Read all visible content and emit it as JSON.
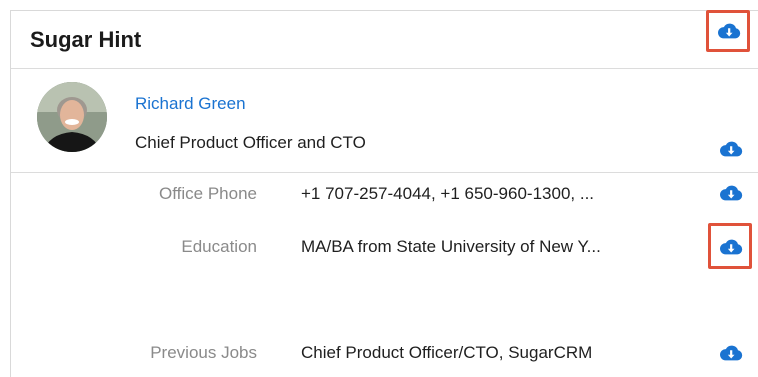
{
  "panel": {
    "title": "Sugar Hint"
  },
  "person": {
    "name": "Richard Green",
    "title": "Chief Product Officer and CTO"
  },
  "fields": [
    {
      "label": "Office Phone",
      "value": "+1 707-257-4044, +1 650-960-1300, ..."
    },
    {
      "label": "Education",
      "value": "MA/BA from State University of New Y..."
    },
    {
      "label": "Previous Jobs",
      "value": "Chief Product Officer/CTO, SugarCRM"
    }
  ],
  "icons": {
    "download": "cloud-download-icon"
  },
  "colors": {
    "accent": "#1a73d1",
    "highlight": "#e0523a",
    "label": "#8a8a8a",
    "divider": "#dcdcdc"
  }
}
